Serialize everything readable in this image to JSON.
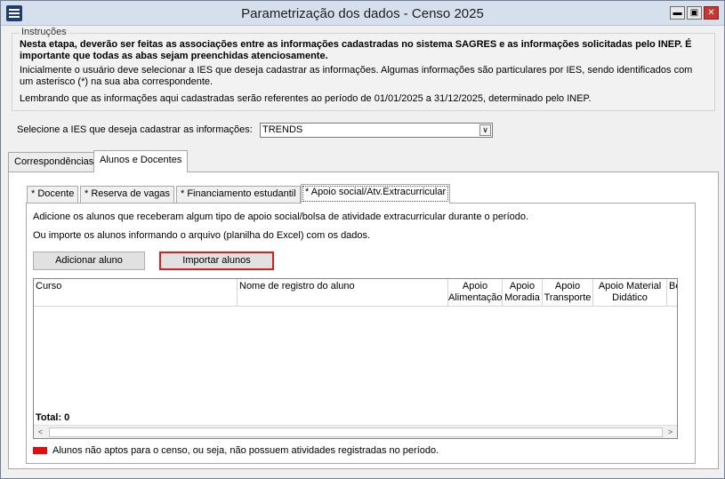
{
  "window": {
    "title": "Parametrização dos dados - Censo 2025",
    "minimize": "▬",
    "maximize": "▣",
    "close": "✕"
  },
  "instructions": {
    "legend": "Instruções",
    "bold_text": "Nesta etapa, deverão ser feitas as associações entre as informações cadastradas no sistema SAGRES e as informações solicitadas pelo INEP. É importante que todas as abas sejam preenchidas atenciosamente.",
    "text1": "Inicialmente o usuário deve selecionar a IES que deseja cadastrar as informações. Algumas informações são particulares por IES, sendo identificados com um asterisco (*) na sua aba correspondente.",
    "text2": "Lembrando que as informações aqui cadastradas serão referentes ao período de 01/01/2025 a 31/12/2025, determinado pelo INEP."
  },
  "ies": {
    "label": "Selecione a IES que deseja cadastrar as informações:",
    "selected": "TRENDS",
    "arrow": "∨"
  },
  "outer_tabs": [
    "Correspondências",
    "Alunos e Docentes"
  ],
  "inner_tabs": [
    "* Docente",
    "* Reserva de vagas",
    "* Financiamento estudantil",
    "* Apoio social/Atv.Extracurricular"
  ],
  "panel": {
    "info1": "Adicione os alunos que receberam algum tipo de apoio social/bolsa de atividade extracurricular durante o período.",
    "info2": "Ou importe os alunos informando o arquivo (planilha do Excel) com os dados.",
    "add_button": "Adicionar aluno",
    "import_button": "Importar alunos"
  },
  "grid": {
    "columns": [
      "Curso",
      "Nome de registro do aluno",
      "Apoio Alimentação",
      "Apoio Moradia",
      "Apoio Transporte",
      "Apoio Material Didático",
      "Bo"
    ],
    "total": "Total: 0",
    "scroll_left": "<",
    "scroll_right": ">"
  },
  "legend": {
    "color": "#e30d0d",
    "text": "Alunos não aptos para o censo, ou seja, não possuem atividades registradas no período."
  }
}
